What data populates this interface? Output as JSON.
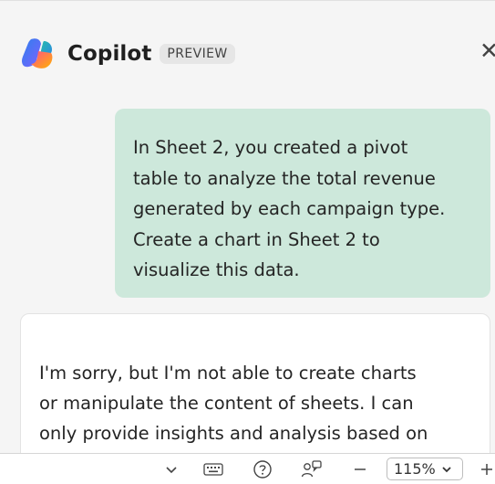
{
  "header": {
    "title": "Copilot",
    "badge": "PREVIEW",
    "close_icon": "close-icon"
  },
  "conversation": {
    "user_message_lines": [
      "In Sheet 2, you created a pivot",
      "table to analyze the total revenue",
      "generated by each campaign type.",
      "Create a chart in Sheet 2 to",
      "visualize this data."
    ],
    "assistant_message_lines": [
      "I'm sorry, but I'm not able to create charts",
      "or manipulate the content of sheets. I can",
      "only provide insights and analysis based on"
    ],
    "user_bubble_color": "#cde8db"
  },
  "statusbar": {
    "icons": [
      "chevron-down-icon",
      "keyboard-icon",
      "help-icon",
      "feedback-icon",
      "zoom-out-icon",
      "zoom-in-icon"
    ],
    "zoom_value": "115%"
  },
  "colors": {
    "logo_gradient": [
      "#1e88e5",
      "#7b61ff",
      "#e64a8f",
      "#ffb300",
      "#00bfa5"
    ]
  }
}
